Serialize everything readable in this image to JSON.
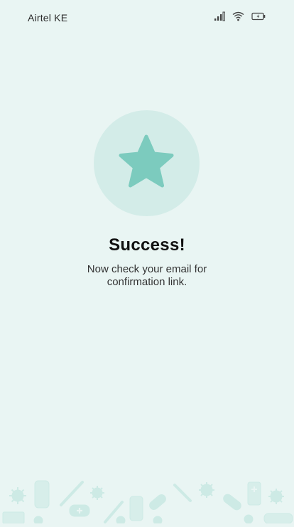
{
  "status_bar": {
    "carrier": "Airtel KE",
    "icons": [
      "signal-icon",
      "wifi-icon",
      "battery-icon"
    ]
  },
  "hero": {
    "icon": "star-icon"
  },
  "title": "Success!",
  "message": "Now check your email for confirmation link.",
  "colors": {
    "background": "#e9f5f3",
    "circle": "#d3ece8",
    "accent": "#7ccbbe"
  }
}
